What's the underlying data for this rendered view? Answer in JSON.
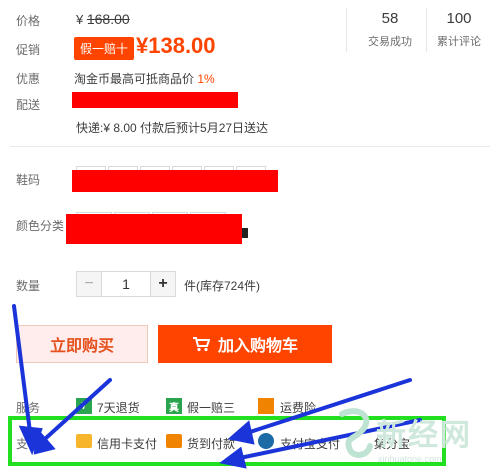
{
  "price": {
    "label": "价格",
    "currency": "¥",
    "value": "168.00"
  },
  "promo": {
    "label": "促销",
    "badge": "假一赔十",
    "price": "¥138.00"
  },
  "stats": [
    {
      "num": "58",
      "label": "交易成功"
    },
    {
      "num": "100",
      "label": "累计评论"
    }
  ],
  "discount": {
    "label": "优惠",
    "text": "淘金币最高可抵商品价",
    "pct": "1%"
  },
  "delivery": {
    "label": "配送",
    "info": "快递:¥ 8.00  付款后预计5月27日送达"
  },
  "size": {
    "label": "鞋码"
  },
  "color": {
    "label": "颜色分类"
  },
  "quantity": {
    "label": "数量",
    "minus": "−",
    "value": "1",
    "plus": "+",
    "unit": "件(库存724件)"
  },
  "buttons": {
    "buy": "立即购买",
    "cart": "加入购物车"
  },
  "services": {
    "label": "服务",
    "items": [
      {
        "icon": "7",
        "text": "7天退货",
        "color": "#2aa44f"
      },
      {
        "icon": "真",
        "text": "假一赔三",
        "color": "#2aa44f"
      },
      {
        "icon": "",
        "text": "运费险",
        "color": "#f08300"
      }
    ]
  },
  "payment": {
    "label": "支付",
    "items": [
      {
        "text": "信用卡支付"
      },
      {
        "text": "货到付款"
      },
      {
        "text": "支付宝支付"
      },
      {
        "text": "集分宝"
      }
    ]
  },
  "watermark": {
    "text": "新经网",
    "sub": "xinhuatone.com"
  }
}
